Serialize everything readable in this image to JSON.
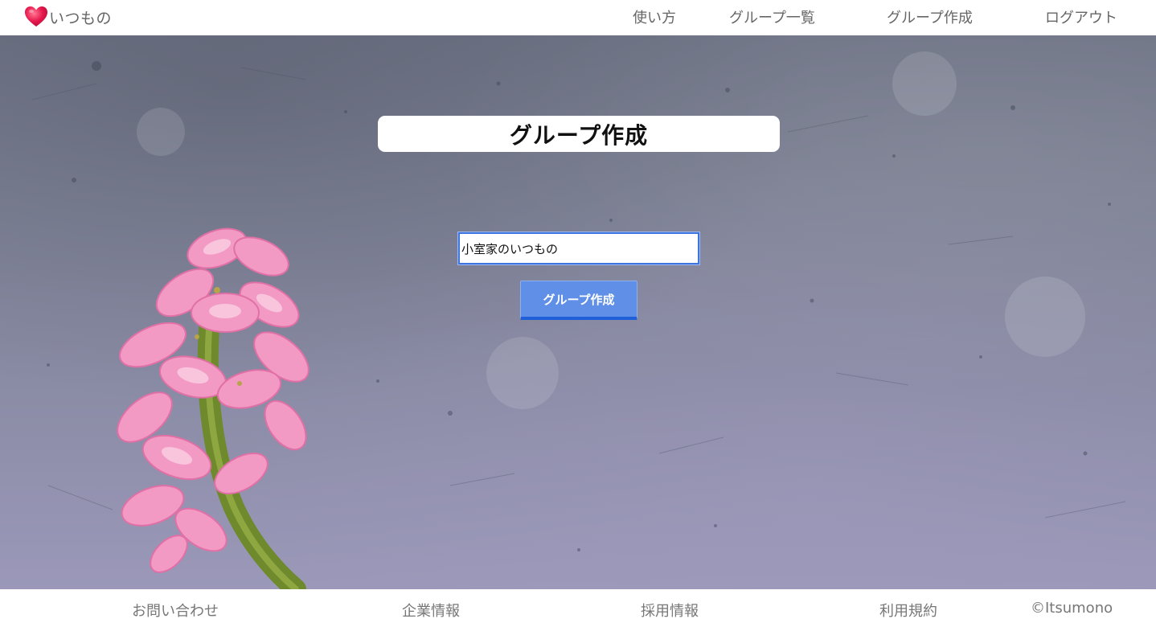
{
  "header": {
    "logo_text": "いつもの",
    "logo_icon": "heart-icon",
    "nav": [
      {
        "label": "使い方"
      },
      {
        "label": "グループ一覧"
      },
      {
        "label": "グループ作成"
      },
      {
        "label": "ログアウト"
      }
    ]
  },
  "main": {
    "title": "グループ作成",
    "group_name_input": {
      "value": "小室家のいつもの",
      "placeholder": ""
    },
    "submit_label": "グループ作成"
  },
  "footer": {
    "links": [
      {
        "label": "お問い合わせ"
      },
      {
        "label": "企業情報"
      },
      {
        "label": "採用情報"
      },
      {
        "label": "利用規約"
      }
    ],
    "copyright": "©Itsumono"
  },
  "colors": {
    "accent": "#5f8fe6",
    "accent_border": "#1f5fd8",
    "heart": "#e8194e",
    "nav_text": "#666666"
  }
}
